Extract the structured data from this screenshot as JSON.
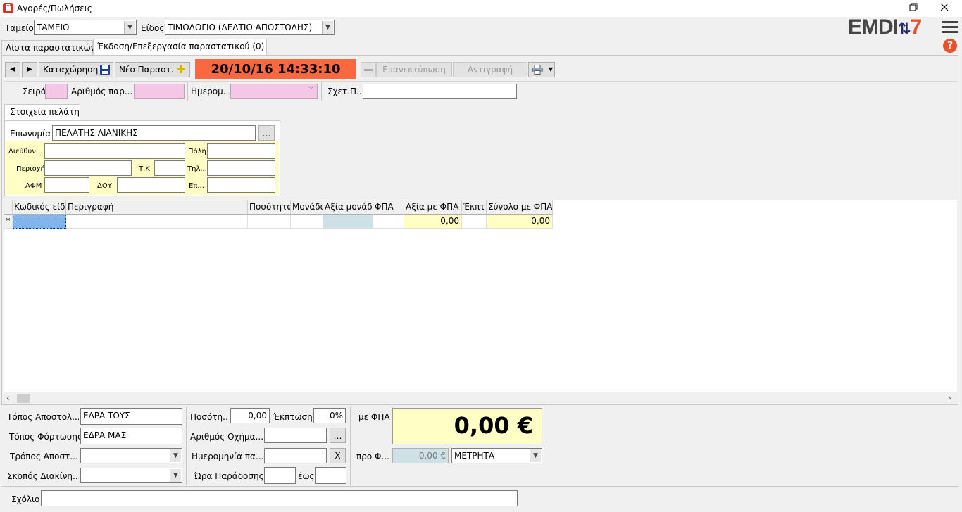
{
  "window": {
    "title": "Αγορές/Πωλήσεις"
  },
  "brand": {
    "logo_text_main": "EMDI",
    "logo_text_num": "7",
    "accent": "#e8512a",
    "navy": "#2b2d6b"
  },
  "top": {
    "tameio_label": "Ταμείο",
    "tameio_value": "ΤΑΜΕΙΟ",
    "eidos_label": "Είδος",
    "eidos_value": "ΤΙΜΟΛΟΓΙΟ (ΔΕΛΤΙΟ ΑΠΟΣΤΟΛΗΣ)"
  },
  "tabs": [
    {
      "label": "Λίστα παραστατικών"
    },
    {
      "label": "Έκδοση/Επεξεργασία παραστατικού (0)"
    }
  ],
  "toolbar": {
    "save_label": "Καταχώρηση",
    "new_label": "Νέο Παραστ.",
    "datetime": "20/10/16 14:33:10",
    "datetime_bg": "#f9683f",
    "reprint_label": "Επανεκτύπωση",
    "copy_label": "Αντιγραφή"
  },
  "doc": {
    "series_label": "Σειρά",
    "number_label": "Αριθμός παρ...",
    "date_label": "Ημερομ...",
    "related_label": "Σχετ.Π..."
  },
  "customer": {
    "tab_label": "Στοιχεία πελάτη",
    "name_label": "Επωνυμία",
    "name_value": "ΠΕΛΑΤΗΣ ΛΙΑΝΙΚΗΣ",
    "address_label": "Διεύθυν...",
    "city_label": "Πόλη",
    "area_label": "Περιοχή",
    "zip_label": "Τ.Κ.",
    "phone_label": "Τηλ...",
    "afm_label": "ΑΦΜ",
    "doy_label": "ΔΟΥ",
    "prof_label": "Επ..."
  },
  "grid": {
    "headers": [
      "Κωδικός είδο",
      "Περιγραφή",
      "Ποσότητα",
      "Μονάδα",
      "Αξία μονάδα",
      "ΦΠΑ",
      "Αξία με ΦΠΑ",
      "Έκπτ",
      "Σύνολο με ΦΠΑ"
    ],
    "new_row_marker": "*",
    "row_value_with_vat": "0,00",
    "row_total_with_vat": "0,00"
  },
  "bottom": {
    "send_place_label": "Τόπος Αποστολ...",
    "send_place_value": "ΕΔΡΑ ΤΟΥΣ",
    "load_place_label": "Τόπος Φόρτωσης",
    "load_place_value": "ΕΔΡΑ ΜΑΣ",
    "send_method_label": "Τρόπος Αποστ...",
    "purpose_label": "Σκοπός Διακίνη...",
    "qty_label": "Ποσότη...",
    "qty_value": "0,00",
    "discount_label": "Έκπτωση",
    "discount_value": "0%",
    "vehicle_label": "Αριθμός Οχήμα...",
    "delivery_date_label": "Ημερομηνία πα...",
    "delivery_date_value": "'",
    "clear_label": "X",
    "delivery_time_label": "Ώρα Παράδοσης",
    "to_label": "έως",
    "with_vat_label": "με ΦΠΑ",
    "total_value": "0,00 €",
    "before_vat_label": "προ Φ...",
    "before_vat_value": "0,00 €",
    "payment_value": "ΜΕΤΡΗΤΑ",
    "comment_label": "Σχόλιο"
  }
}
